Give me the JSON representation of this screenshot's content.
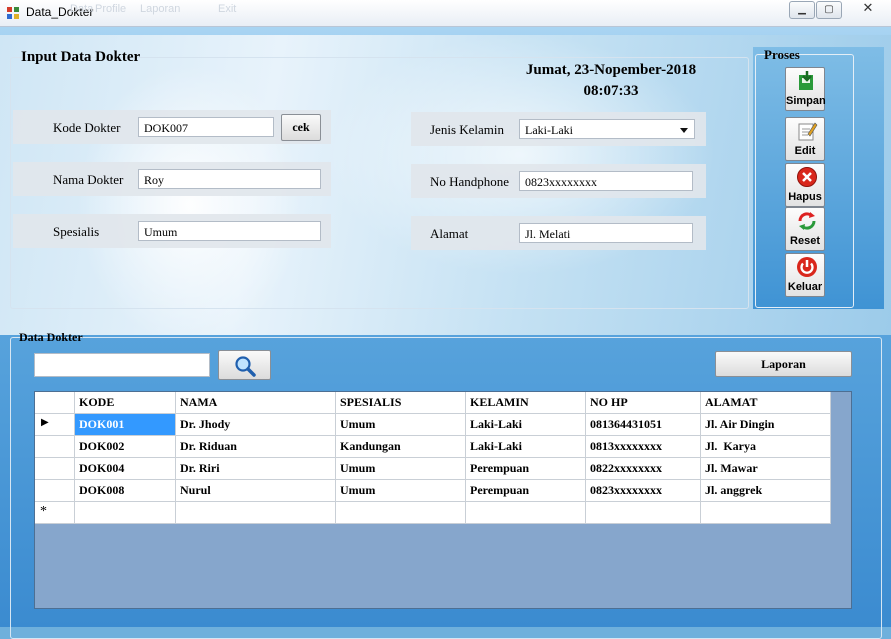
{
  "window": {
    "title": "Data_Dokter",
    "menu_ghost": [
      "Data",
      "Profile",
      "Laporan",
      "Exit"
    ]
  },
  "input_group": {
    "legend": "Input Data Dokter",
    "date": "Jumat, 23-Nopember-2018",
    "time": "08:07:33",
    "kode_label": "Kode Dokter",
    "kode_value": "DOK007",
    "cek_label": "cek",
    "nama_label": "Nama Dokter",
    "nama_value": "Roy",
    "spesialis_label": "Spesialis",
    "spesialis_value": "Umum",
    "kelamin_label": "Jenis Kelamin",
    "kelamin_value": "Laki-Laki",
    "hp_label": "No Handphone",
    "hp_value": "0823xxxxxxxx",
    "alamat_label": "Alamat",
    "alamat_value": "Jl. Melati"
  },
  "proses": {
    "legend": "Proses",
    "buttons": [
      {
        "label": "Simpan",
        "icon": "save-icon"
      },
      {
        "label": "Edit",
        "icon": "edit-icon"
      },
      {
        "label": "Hapus",
        "icon": "delete-icon"
      },
      {
        "label": "Reset",
        "icon": "refresh-icon"
      },
      {
        "label": "Keluar",
        "icon": "power-icon"
      }
    ]
  },
  "data_group": {
    "legend": "Data Dokter",
    "search_value": "",
    "search_icon": "search-icon",
    "laporan_label": "Laporan",
    "columns": [
      "KODE",
      "NAMA",
      "SPESIALIS",
      "KELAMIN",
      "NO HP",
      "ALAMAT"
    ],
    "rows": [
      {
        "cells": [
          "DOK001",
          "Dr. Jhody",
          "Umum",
          "Laki-Laki",
          "081364431051",
          "Jl. Air Dingin"
        ]
      },
      {
        "cells": [
          "DOK002",
          "Dr. Riduan",
          "Kandungan",
          "Laki-Laki",
          "0813xxxxxxxx",
          "Jl.  Karya"
        ]
      },
      {
        "cells": [
          "DOK004",
          "Dr. Riri",
          "Umum",
          "Perempuan",
          "0822xxxxxxxx",
          "Jl. Mawar"
        ]
      },
      {
        "cells": [
          "DOK008",
          "Nurul",
          "Umum",
          "Perempuan",
          "0823xxxxxxxx",
          "Jl. anggrek"
        ]
      }
    ],
    "current_marker": "▶",
    "new_row_marker": "*"
  },
  "colors": {
    "selection": "#3399ff",
    "grid_background": "#86a6cc",
    "window_client": "#5fa9df"
  }
}
